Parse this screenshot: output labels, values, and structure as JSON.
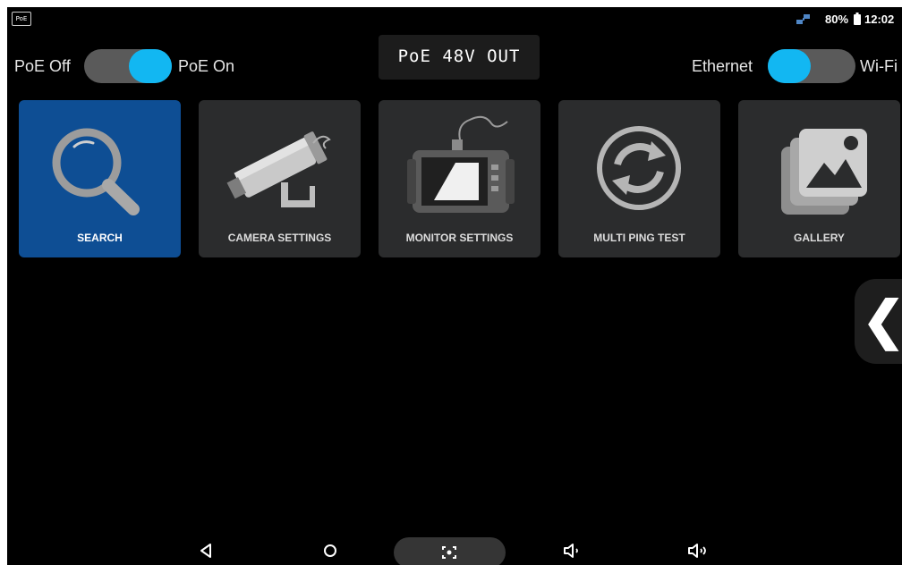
{
  "status_bar": {
    "poe_badge": "PoE",
    "battery_percent": "80%",
    "time": "12:02"
  },
  "poe_toggle": {
    "off_label": "PoE Off",
    "on_label": "PoE On",
    "state": "on"
  },
  "net_toggle": {
    "left_label": "Ethernet",
    "right_label": "Wi-Fi",
    "state": "ethernet"
  },
  "poe_readout": "PoE 48V OUT",
  "tiles": [
    {
      "label": "SEARCH",
      "icon": "search-icon",
      "selected": true
    },
    {
      "label": "CAMERA SETTINGS",
      "icon": "camera-icon",
      "selected": false
    },
    {
      "label": "MONITOR SETTINGS",
      "icon": "monitor-icon",
      "selected": false
    },
    {
      "label": "MULTI PING TEST",
      "icon": "refresh-icon",
      "selected": false
    },
    {
      "label": "GALLERY",
      "icon": "gallery-icon",
      "selected": false
    }
  ],
  "side_handle": {
    "glyph": "❮"
  },
  "nav_bar": {
    "buttons": [
      "back-icon",
      "home-icon",
      "screenshot-icon",
      "volume-down-icon",
      "volume-up-icon"
    ]
  },
  "colors": {
    "accent": "#12b7f2",
    "tile_selected": "#0e4e94",
    "tile": "#2b2c2d",
    "background": "#000000"
  }
}
